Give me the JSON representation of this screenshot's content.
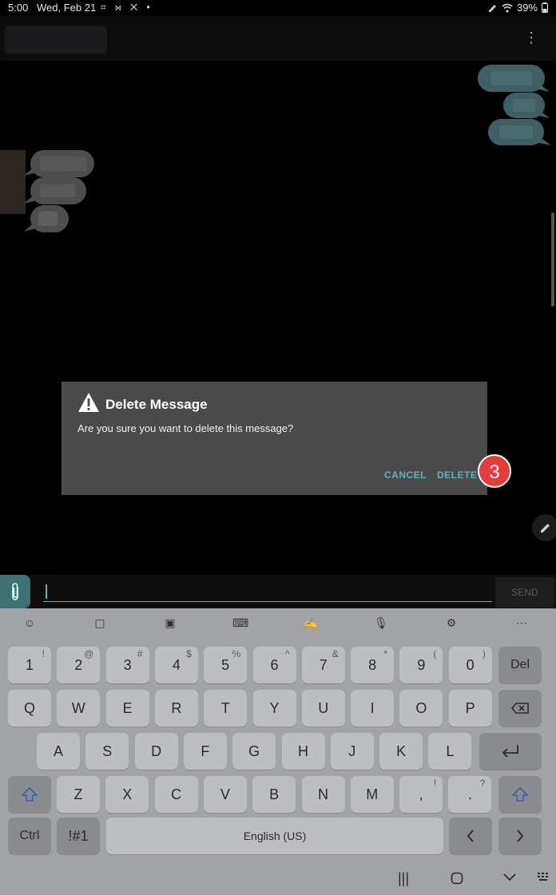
{
  "status": {
    "time": "5:00",
    "date": "Wed, Feb 21",
    "notif_icons": "⌗ ⋈ ✕ •",
    "battery": "39%"
  },
  "dialog": {
    "title": "Delete Message",
    "message": "Are you sure you want to delete this message?",
    "cancel_label": "CANCEL",
    "delete_label": "DELETE",
    "step": "3"
  },
  "compose": {
    "send_label": "SEND",
    "value": ""
  },
  "keyboard": {
    "toolbar": [
      "emoji-icon",
      "clipboard-icon",
      "sticker-icon",
      "keyboard-mode-icon",
      "handwriting-icon",
      "mic-icon",
      "settings-icon",
      "more-icon"
    ],
    "row1": [
      {
        "k": "1",
        "s": "!"
      },
      {
        "k": "2",
        "s": "@"
      },
      {
        "k": "3",
        "s": "#"
      },
      {
        "k": "4",
        "s": "$"
      },
      {
        "k": "5",
        "s": "%"
      },
      {
        "k": "6",
        "s": "^"
      },
      {
        "k": "7",
        "s": "&"
      },
      {
        "k": "8",
        "s": "*"
      },
      {
        "k": "9",
        "s": "("
      },
      {
        "k": "0",
        "s": ")"
      }
    ],
    "del": "Del",
    "row2": [
      "Q",
      "W",
      "E",
      "R",
      "T",
      "Y",
      "U",
      "I",
      "O",
      "P"
    ],
    "row3": [
      "A",
      "S",
      "D",
      "F",
      "G",
      "H",
      "J",
      "K",
      "L"
    ],
    "row4": [
      "Z",
      "X",
      "C",
      "V",
      "B",
      "N",
      "M"
    ],
    "comma": ",",
    "comma_sup": "!",
    "period": ".",
    "period_sup": "?",
    "ctrl": "Ctrl",
    "symbols": "!#1",
    "space": "English (US)"
  }
}
